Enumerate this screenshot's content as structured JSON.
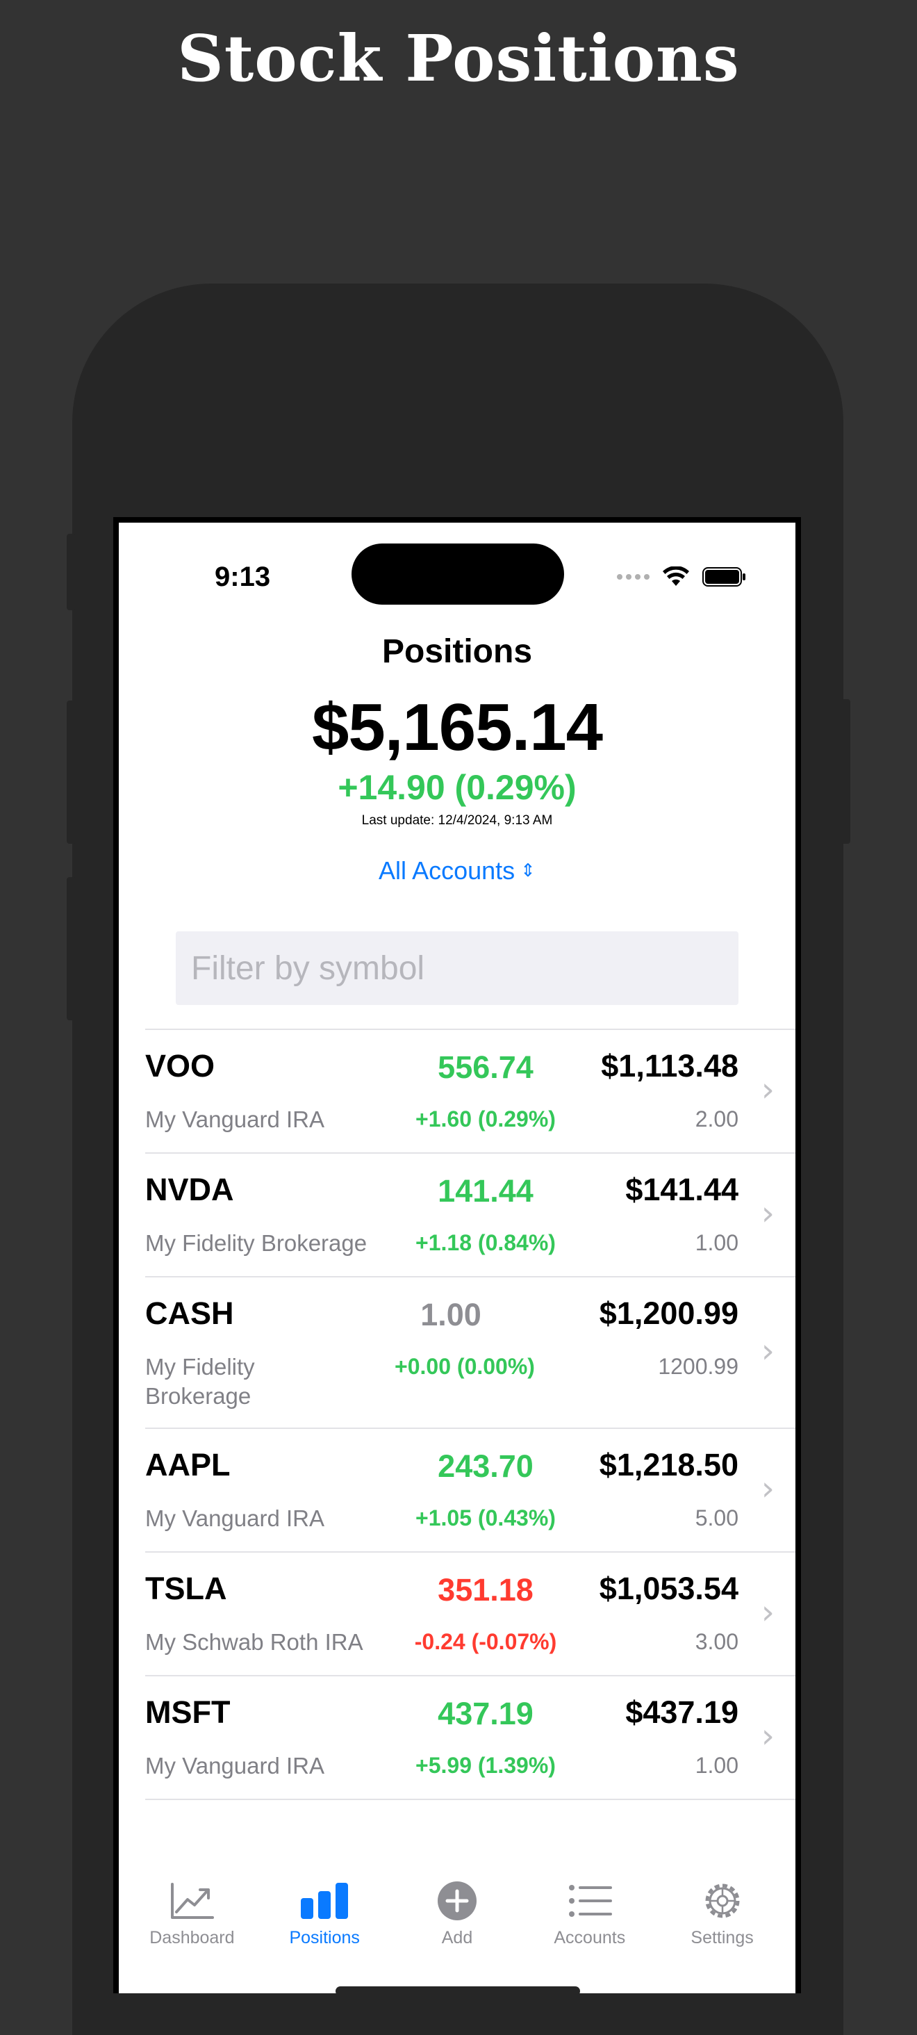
{
  "marketing": {
    "title": "Stock Positions"
  },
  "status_bar": {
    "time": "9:13",
    "icons": [
      "signal-dots-icon",
      "wifi-icon",
      "battery-icon"
    ]
  },
  "header": {
    "title": "Positions",
    "total_value": "$5,165.14",
    "total_change": "+14.90 (0.29%)",
    "last_update": "Last update: 12/4/2024, 9:13 AM",
    "account_selector": "All Accounts"
  },
  "filter": {
    "placeholder": "Filter by symbol",
    "value": ""
  },
  "colors": {
    "accent": "#0a7aff",
    "gain": "#34c759",
    "loss": "#ff3b30",
    "neutral": "#8e8e93"
  },
  "positions": [
    {
      "symbol": "VOO",
      "account": "My Vanguard IRA",
      "price": "556.74",
      "change": "+1.60 (0.29%)",
      "value": "$1,113.48",
      "shares": "2.00",
      "trend": "up"
    },
    {
      "symbol": "NVDA",
      "account": "My Fidelity Brokerage",
      "price": "141.44",
      "change": "+1.18 (0.84%)",
      "value": "$141.44",
      "shares": "1.00",
      "trend": "up"
    },
    {
      "symbol": "CASH",
      "account": "My Fidelity Brokerage",
      "price": "1.00",
      "change": "+0.00 (0.00%)",
      "value": "$1,200.99",
      "shares": "1200.99",
      "trend": "flat"
    },
    {
      "symbol": "AAPL",
      "account": "My Vanguard IRA",
      "price": "243.70",
      "change": "+1.05 (0.43%)",
      "value": "$1,218.50",
      "shares": "5.00",
      "trend": "up"
    },
    {
      "symbol": "TSLA",
      "account": "My Schwab Roth IRA",
      "price": "351.18",
      "change": "-0.24 (-0.07%)",
      "value": "$1,053.54",
      "shares": "3.00",
      "trend": "down"
    },
    {
      "symbol": "MSFT",
      "account": "My Vanguard IRA",
      "price": "437.19",
      "change": "+5.99 (1.39%)",
      "value": "$437.19",
      "shares": "1.00",
      "trend": "up"
    }
  ],
  "tabs": [
    {
      "label": "Dashboard",
      "icon": "chart-line-icon",
      "active": false
    },
    {
      "label": "Positions",
      "icon": "bar-chart-icon",
      "active": true
    },
    {
      "label": "Add",
      "icon": "plus-circle-icon",
      "active": false
    },
    {
      "label": "Accounts",
      "icon": "list-icon",
      "active": false
    },
    {
      "label": "Settings",
      "icon": "gear-icon",
      "active": false
    }
  ]
}
